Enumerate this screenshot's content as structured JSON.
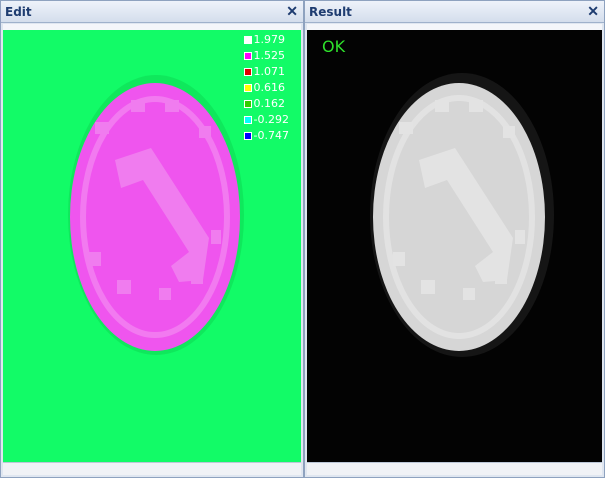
{
  "edit_panel": {
    "title": "Edit",
    "close_glyph": "✕",
    "legend": [
      {
        "label": "1.979",
        "color": "#ffffff"
      },
      {
        "label": "1.525",
        "color": "#ff00ff"
      },
      {
        "label": "1.071",
        "color": "#e00000"
      },
      {
        "label": "0.616",
        "color": "#ffff00"
      },
      {
        "label": "0.162",
        "color": "#33cc00"
      },
      {
        "label": "-0.292",
        "color": "#00ffff"
      },
      {
        "label": "-0.747",
        "color": "#0000ff"
      }
    ],
    "background_color": "#12fb67",
    "coin_color": "#ef55ee"
  },
  "result_panel": {
    "title": "Result",
    "close_glyph": "✕",
    "status_text": "OK",
    "status_color": "#2ee02b",
    "background_color": "#030303",
    "coin_color": "#d6d6d6"
  }
}
